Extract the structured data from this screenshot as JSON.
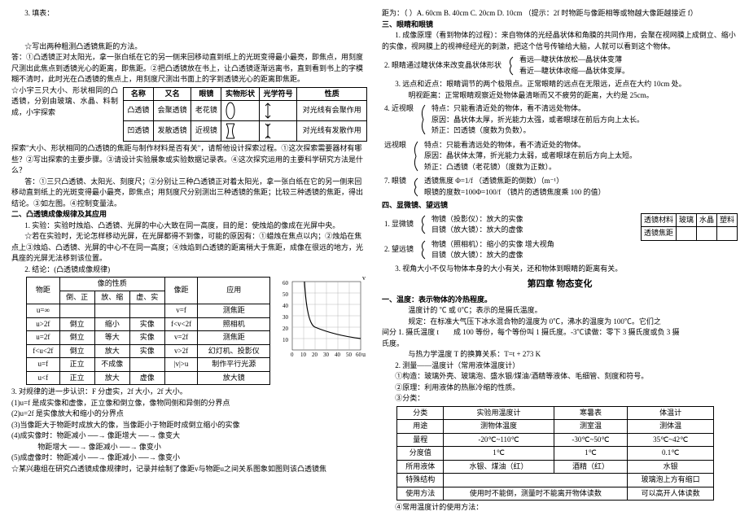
{
  "left": {
    "line1": "3. 填表：",
    "line2": "☆写出两种粗测凸透镜焦距的方法。",
    "line3": "答：①凸透镜正对太阳光，拿一张白纸在它的另一侧来回移动直到纸上的光斑变得最小最亮，即焦点，用刻度尺测出此焦点到透镜光心的距离，即焦距。②把凸透镜放在书上，让凸透镜逐渐远离书，直到看到书上的字模糊不清时，此时光在凸透镜的焦点上，用刻度尺测出书面上的字到透镜光心的距离即焦距。",
    "tbl1": {
      "header": [
        "名称",
        "又名",
        "眼镜",
        "实物形状",
        "光学符号",
        "性质"
      ],
      "row1": [
        "凸透镜",
        "会聚透镜",
        "老花镜",
        "",
        "",
        "对光线有会聚作用"
      ],
      "row2": [
        "凹透镜",
        "发散透镜",
        "近视镜",
        "",
        "",
        "对光线有发散作用"
      ]
    },
    "pre1": "☆小宇三只大小、形状相同的凸透镜，分别由玻璃、水晶、料制成，小宇探索",
    "line4": "探索\"大小、形状相同的凸透镜的焦距与制作材料是否有关\"，请帮他设计探索过程。①这次探索需要器材有哪些？②写出探索的主要步骤。③请设计实验展象或实验数据记录表。④这次探究运用的主要科学研究方法是什么？",
    "line5": "答：①三只凸透镜、太阳光、刻度尺；②分别让三种凸透镜正对着太阳光，拿一张白纸在它的另一侧来回移动直到纸上的光斑变得最小最亮，即焦点；用刻度尺分别测出三种透镜的焦距；比较三种透镜的焦距，得出结论。③如左图。④控制变量法。",
    "sec2title": "二、凸透镜成像规律及其应用",
    "line6": "1. 实验：实验时烛焰、凸透镜、光屏的中心大致在同一高度，目的是：使烛焰的像成在光屏中央。",
    "line7": "☆若在实验时，无论怎样移动光屏，在光屏都得不到像，可能的原因有：①蜡烛在焦点以内；②烛焰在焦点上③烛焰、凸透镜、光屏的中心不在同一高度；④烛焰到凸透镜的距离稍大于焦距，成像在很远的地方，光具座的光屏无法移到该位置。",
    "line8": "2. 结论：(凸透镜成像规律)",
    "tbl2": {
      "h1": "像的性质",
      "h2": "物距",
      "h3": "倒、正",
      "h4": "放、缩",
      "h5": "虚、实",
      "h6": "像距",
      "h7": "应用",
      "r1": [
        "u=∞",
        "",
        "",
        "",
        "v=f",
        "测焦距"
      ],
      "r2": [
        "u>2f",
        "倒立",
        "缩小",
        "实像",
        "f<v<2f",
        "照相机"
      ],
      "r3": [
        "u=2f",
        "倒立",
        "等大",
        "实像",
        "v=2f",
        "测焦距"
      ],
      "r4": [
        "f<u<2f",
        "倒立",
        "放大",
        "实像",
        "v>2f",
        "幻灯机、投影仪"
      ],
      "r5": [
        "u=f",
        "正立",
        "不成像",
        "",
        "|v|>u",
        "制作平行光源"
      ],
      "r6": [
        "u<f",
        "正立",
        "放大",
        "虚像",
        "",
        "放大镜"
      ]
    },
    "line9": "3. 对规律的进一步认识：F 分虚实，2f 大小，2f 大小。",
    "line10": "(1)u=f 是成实像和虚像，正立像和倒立像，像物同侧和异侧的分界点",
    "line11": "(2)u=2f 是实像放大和缩小的分界点",
    "line12": "(3)当像距大于物距时成放大的像，当像距小于物距时成倒立缩小的实像",
    "line13a": "(4)成实像时：",
    "line13b": "物距减小 ──→ 像距增大 ──→ 像变大",
    "line13c": "物距增大 ──→ 像距减小 ──→ 像变小",
    "line14a": "(5)成虚像时：",
    "line14b": "物距减小 ──→ 像距减小 ──→ 像变小",
    "line14c": "☆某兴趣组在研究凸透镜成像规律时，记录并绘制了像距v与物距u之间关系图象如图则该凸透镜焦",
    "chart_data": {
      "type": "line",
      "xlabel": "u",
      "ylabel": "v",
      "x": [
        0,
        10,
        20,
        30,
        40,
        50,
        60
      ],
      "yticks": [
        10,
        20,
        30,
        40,
        50,
        60
      ],
      "series": [
        {
          "name": "v-u",
          "note": "hyperbola through (20,20), asymptote u=10"
        }
      ]
    }
  },
  "right": {
    "line1": "距为：（   ）A. 60cm   B. 40cm   C. 20cm   D. 10cm  （提示：2f 时物距与像距相等或物越大像距越接近 f）",
    "sec3title": "三、眼睛和眼镜",
    "line2": "1. 成像原理（看到物体的过程）：来自物体的光经晶状体和角膜的共同作用，会聚在视网膜上成倒立、缩小的实像，视网膜上的视神经经光的刺激，把这个信号传输给大脑，人就可以看到这个物体。",
    "line3pre": "2. 眼睛通过睫状体来改变晶状体形状",
    "line3a": "看远—睫状体放松—晶状体变薄",
    "line3b": "看近—睫状体收缩—晶状体变厚。",
    "line4": "3. 远点和近点：眼睛调节的两个极限点。正常眼睛的远点在无限远，近点在大约 10cm 处。",
    "line5": "明视距离：正常眼睛观察近处物体最清晰而又不疲劳的距离，大约是 25cm。",
    "line6": "4. 近视眼",
    "nearA": "特点：只能看清近处的物体，看不清远处物体。",
    "nearB": "原因：晶状体太厚，折光能力太强，或者眼球在前后方向上太长。",
    "nearC": "矫正：凹透镜（度数为负数）。",
    "farLbl": "   远视眼",
    "farA": "特点：只能看清远处的物体，看不清近处的物体。",
    "farB": "原因：晶状体太薄，折光能力太弱，或者眼球在前后方向上太短。",
    "farC": "矫正：凸透镜（老花镜）（度数为正数）。",
    "line7p": "7. 眼镜",
    "line7a": "透镜焦度 Φ=1/f  （透镜焦距的倒数）（m⁻¹）",
    "line7b": "眼镜的度数=100Φ=100/f （镜片的透镜焦度乘 100 的值）",
    "sec4title": "四、显微镜、望远镜",
    "line8": "1. 显微镜",
    "line8a": "物镜（投影仪）：放大的实像",
    "line8b": "目镜（放大镜）：放大的虚像",
    "line9": "2. 望远镜",
    "line9a": "物镜（照相机）：缩小的实像       增大视角",
    "line9b": "目镜（放大镜）：放大的虚像",
    "tblMat": {
      "h": [
        "透镜材料",
        "玻璃",
        "水晶",
        "塑料"
      ],
      "r": [
        "透镜焦距",
        "",
        "",
        ""
      ]
    },
    "line10": "3. 视角大小不仅与物体本身的大小有关，还和物体到眼睛的距离有关。",
    "ch4title": "第四章  物态变化",
    "tempSec": "一、温度：表示物体的冷热程度。",
    "t1": "温度计的 ℃ 或 0℃；表示的是摄氏温度。",
    "t2": "规定：在标准大气压下冰水混合物的温度为 0℃，沸水的温度为 100℃。它们之",
    "t3pre": "间分",
    "t3": "1. 摄氏温度 t",
    "t3b": "成 100 等份，每个等份叫 1 摄氏度。-3℃读做：零下 3 摄氏度或负 3 摄",
    "t3c": "氏度。",
    "t4": "与热力学温度 T 的换算关系：T=t + 273 K",
    "line11": "2. 测量——温度计（常用液体温度计）",
    "line12": "①构造：玻璃外壳、玻璃泡、盛水银/煤油/酒精等液体、毛细管、刻度和符号。",
    "line13": "②原理：利用液体的热胀冷缩的性质。",
    "line14": "③分类：",
    "tbl3": {
      "h": [
        "分类",
        "实验用温度计",
        "寒暑表",
        "体温计"
      ],
      "r1": [
        "用途",
        "测物体温度",
        "测室温",
        "测体温"
      ],
      "r2": [
        "量程",
        "-20℃~110℃",
        "-30℃~50℃",
        "35℃~42℃"
      ],
      "r3": [
        "分度值",
        "1℃",
        "1℃",
        "0.1℃"
      ],
      "r4": [
        "所用液体",
        "水银、煤油（红）",
        "酒精（红）",
        "水银"
      ],
      "r5": [
        "特殊结构",
        "",
        "",
        "玻璃泡上方有缩口"
      ],
      "r6": [
        "使用方法",
        "使用时不能倒，测量时不能离开物体读数",
        "",
        "可以高开人体读数"
      ]
    },
    "line15": "④常用温度计的使用方法："
  }
}
